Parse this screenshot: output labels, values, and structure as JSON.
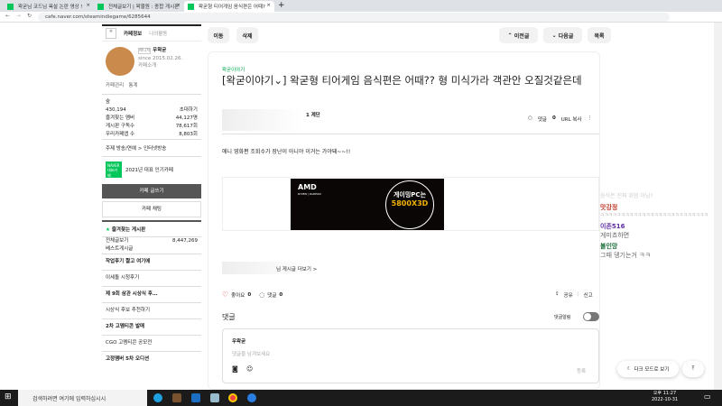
{
  "browser": {
    "tabs": [
      {
        "label": "왁굳님 코드님 욕설 논란 영상 !"
      },
      {
        "label": "전체글보기 | 왁물원 : 종합 게시판"
      },
      {
        "label": "왁굳형 티어게임 음식편은 어때?"
      }
    ],
    "new_tab": "+",
    "url": "cafe.naver.com/steamindiegame/6285644"
  },
  "sidebar": {
    "tab_info": "카페정보",
    "tab_activity": "나의활동",
    "manager_badge": "매니저",
    "manager": "우왁굳",
    "since": "since 2015.02.26.",
    "intro": "카페소개",
    "manage": "카페관리",
    "stats": "통계",
    "level": "숲",
    "members": "430,194",
    "invite": "초대하기",
    "rows": [
      {
        "label": "즐겨찾는 멤버",
        "value": "44,127명"
      },
      {
        "label": "게시판 구독수",
        "value": "78,617회"
      },
      {
        "label": "우리카페앱 수",
        "value": "8,803회"
      }
    ],
    "topic": "주제  방송/연예 > 인터넷방송",
    "naver_badge": "NAVER 대표카페",
    "award": "2021년 대표 인기카페",
    "write": "카페 글쓰기",
    "chat": "카페 채팅",
    "fav_boards": "즐겨찾는 게시판",
    "all_posts": "전체글보기",
    "all_count": "8,447,269",
    "best": "베스트게시글",
    "menu": [
      {
        "text": "작업후기 짤고 여기에",
        "bold": true
      },
      {
        "text": "이세돌 시청후기",
        "bold": false
      },
      {
        "text": "제 9회 삼관 시상식 후…",
        "bold": true
      },
      {
        "text": "시상식 후보 추천하기",
        "bold": false
      },
      {
        "text": "2차 고멤티콘 발매",
        "bold": true
      },
      {
        "text": "CGO 고멤티콘 공모전",
        "bold": false
      },
      {
        "text": "고정멤버 5차 오디션",
        "bold": true
      }
    ]
  },
  "toolbar": {
    "move": "이동",
    "delete": "삭제",
    "prev": "이전글",
    "next": "다음글",
    "list": "목록"
  },
  "article": {
    "board": "왁굳이야기",
    "title": "[왁굳이야기⌄] 왁굳형 티어게임 음식편은 어때?? 형 미식가라 객관안 오질것같은데",
    "author_level": "1 계단",
    "comments_label": "댓글",
    "comments_count": "0",
    "url_copy": "URL 복사",
    "body": "애니 영화편  조회수가 장난이 아니야 이거는 가야돼~~!!",
    "ad_brand": "AMD",
    "ad_sub": "RYZEN | RADEON",
    "ad_line1": "게이밍PC는",
    "ad_line2": "5800X3D",
    "more_posts": "님 게시글 더보기 >",
    "like": "좋아요",
    "like_count": "0",
    "comment": "댓글",
    "share": "공유",
    "report": "신고",
    "comments_title": "댓글",
    "alarm": "댓글알림",
    "commenter": "우왁굳",
    "comment_placeholder": "댓글을 남겨보세요",
    "submit": "등록"
  },
  "chat": {
    "top": "음식은 진짜 위험 아님?",
    "messages": [
      {
        "name": "맛강정",
        "color": "#c0392b",
        "text": "ㅋㅋㅋㅋㅋㅋㅋㅋㅋㅋㅋㅋㅋㅋㅋㅋㅋㅋㅋㅋㅋㅋㅋㅋㅋㅋ"
      },
      {
        "name": "이존516",
        "color": "#5b2ca0",
        "text": "게미쵸하면"
      },
      {
        "name": "불인망",
        "color": "#1a6b3a",
        "text": "그때 뎅기는거 ㅋㅋ"
      }
    ]
  },
  "float": {
    "dark": "다크 모드로 보기"
  },
  "taskbar": {
    "search": "검색하려면 여기에 입력하십시시",
    "ampm": "오후 11:27",
    "date": "2022-10-31"
  }
}
